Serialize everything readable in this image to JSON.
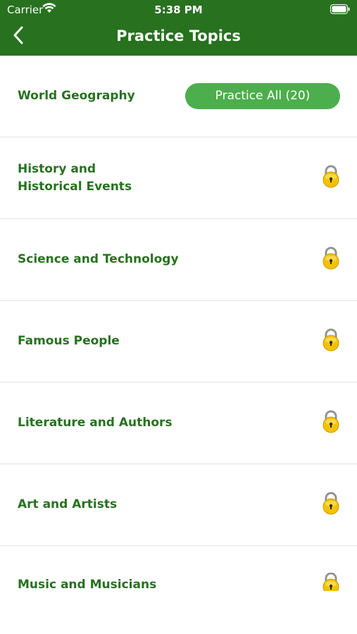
{
  "status_bar": {
    "carrier": "Carrier",
    "time": "5:38 PM"
  },
  "nav": {
    "back_icon": "chevron-left-icon",
    "title": "Practice Topics"
  },
  "colors": {
    "header_green": "#27711f",
    "text_green": "#27711f",
    "button_green": "#4cae4c",
    "lock_gold": "#f2c200"
  },
  "topics": [
    {
      "label": "World Geography",
      "action": "Practice All (20)",
      "locked": false
    },
    {
      "label": "History and\nHistorical Events",
      "locked": true
    },
    {
      "label": "Science and Technology",
      "locked": true
    },
    {
      "label": "Famous People",
      "locked": true
    },
    {
      "label": "Literature and Authors",
      "locked": true
    },
    {
      "label": "Art and Artists",
      "locked": true
    },
    {
      "label": "Music and Musicians",
      "locked": true
    }
  ]
}
